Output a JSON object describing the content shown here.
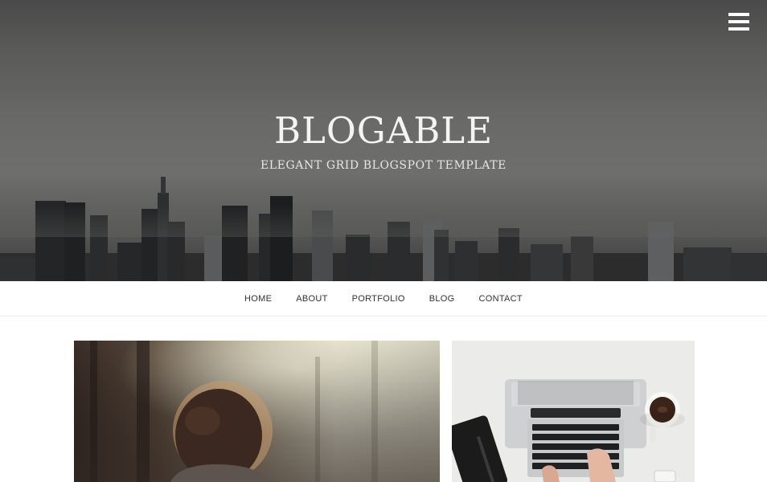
{
  "site": {
    "title": "BLOGABLE",
    "tagline": "ELEGANT GRID BLOGSPOT TEMPLATE"
  },
  "header": {
    "menu_icon": "hamburger-menu-icon"
  },
  "nav": {
    "items": [
      "HOME",
      "ABOUT",
      "PORTFOLIO",
      "BLOG",
      "CONTACT"
    ]
  },
  "posts": [
    {
      "image": "woman-in-forest-photo"
    },
    {
      "image": "laptop-on-desk-photo"
    }
  ],
  "colors": {
    "hero_dark": "#3e3e3e",
    "hero_mid": "#6a6a69",
    "text_light": "#f4f4f4",
    "nav_text": "#333333"
  }
}
